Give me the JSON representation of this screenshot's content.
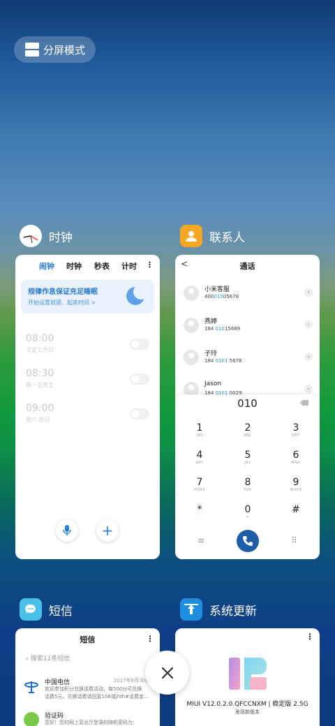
{
  "split_mode": {
    "label": "分屏模式"
  },
  "apps": {
    "clock": {
      "name": "时钟",
      "tabs": [
        "闹钟",
        "时钟",
        "秒表",
        "计时"
      ],
      "banner": {
        "title": "规律作息保证充足睡眠",
        "subtitle": "开始设置就寝、起床时间 >"
      },
      "alarms": [
        {
          "time": "08:00",
          "repeat": "法定工作日"
        },
        {
          "time": "08:30",
          "repeat": "周一至周五"
        },
        {
          "time": "09:00",
          "repeat": "周六 周日"
        }
      ],
      "add_label": "+"
    },
    "contacts": {
      "name": "联系人",
      "title": "通话",
      "back": "<",
      "contacts": [
        {
          "name": "小米客服",
          "pre": "400",
          "hl": "010",
          "post": "05678"
        },
        {
          "name": "燕婷",
          "pre": "184 ",
          "hl": "010",
          "post": "15689"
        },
        {
          "name": "子玲",
          "pre": "184 ",
          "hl": "0101",
          "post": " 5678"
        },
        {
          "name": "Jason",
          "pre": "184 ",
          "hl": "0101",
          "post": " 0029"
        }
      ],
      "dial_input": "010",
      "keys": [
        {
          "d": "1",
          "l": "QD"
        },
        {
          "d": "2",
          "l": "ABC"
        },
        {
          "d": "3",
          "l": "DEF"
        },
        {
          "d": "4",
          "l": "GHI"
        },
        {
          "d": "5",
          "l": "JKL"
        },
        {
          "d": "6",
          "l": "MNO"
        },
        {
          "d": "7",
          "l": "PQRS"
        },
        {
          "d": "8",
          "l": "TUV"
        },
        {
          "d": "9",
          "l": "WXYZ"
        },
        {
          "d": "*",
          "l": ","
        },
        {
          "d": "0",
          "l": "+"
        },
        {
          "d": "#",
          "l": ""
        }
      ],
      "menu_icon": "≡",
      "grid_icon": "⠿"
    },
    "sms": {
      "name": "短信",
      "title": "短信",
      "search_placeholder": "搜索11条短信",
      "messages": [
        {
          "from": "中国电信",
          "date": "2017年6月30日",
          "body1": "欢迎参加积分兑换话费活动，每500分可兑换",
          "body2": "话费5元，兑换话费请回复106或jfdh#话费金..."
        },
        {
          "from": "验证码",
          "date": "",
          "body1": "您好！您的网上营业厅登录的随机密码为：",
          "body2": ""
        }
      ]
    },
    "update": {
      "name": "系统更新",
      "version": "MIUI V12.0.2.0.QFCCNXM | 稳定版 2.5G",
      "subtitle": "发现新版本"
    }
  },
  "more_icon": "⋮",
  "close_label": "×"
}
